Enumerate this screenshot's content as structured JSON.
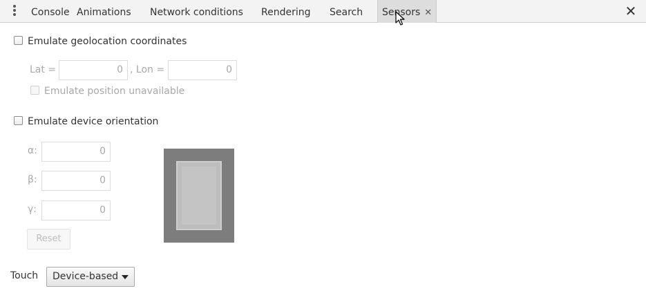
{
  "tabs": [
    {
      "label": "Console"
    },
    {
      "label": "Animations"
    },
    {
      "label": "Network conditions"
    },
    {
      "label": "Rendering"
    },
    {
      "label": "Search"
    },
    {
      "label": "Sensors",
      "close": "✕",
      "selected": true
    }
  ],
  "drawer_close": "✕",
  "geolocation": {
    "checkbox_label": "Emulate geolocation coordinates",
    "lat_label": "Lat =",
    "lat_value": "0",
    "lon_label": ", Lon =",
    "lon_value": "0",
    "unavailable_label": "Emulate position unavailable"
  },
  "orientation": {
    "checkbox_label": "Emulate device orientation",
    "alpha_label": "α:",
    "alpha_value": "0",
    "beta_label": "β:",
    "beta_value": "0",
    "gamma_label": "γ:",
    "gamma_value": "0",
    "reset_label": "Reset"
  },
  "touch": {
    "label": "Touch",
    "selected": "Device-based"
  },
  "icons": {
    "menu": "kebab-menu-icon",
    "tab_close": "close-icon",
    "drawer_close": "close-icon",
    "cursor": "mouse-cursor-icon",
    "dropdown": "triangle-down-icon"
  },
  "colors": {
    "tabbar_bg": "#f3f3f3",
    "selected_tab_bg": "#dddddd",
    "disabled_text": "#a8a8a8",
    "orientation_bg": "#7d7d7d",
    "orientation_screen": "#bdbdbd"
  }
}
